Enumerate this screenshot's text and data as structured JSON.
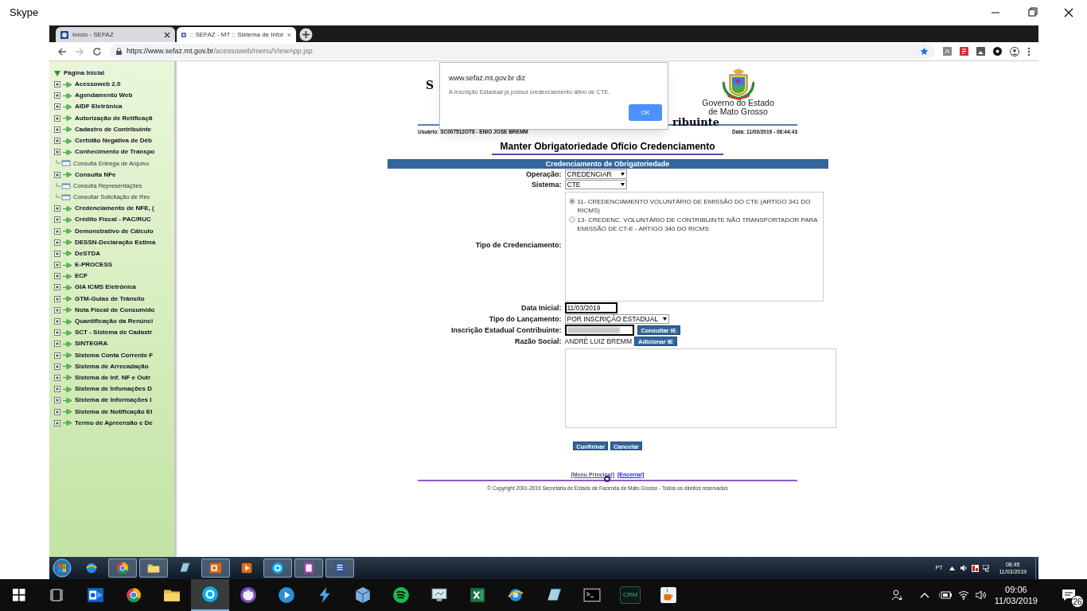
{
  "app_title": "Skype",
  "browser": {
    "tabs": [
      {
        "title": "Início - SEFAZ",
        "selected": false
      },
      {
        "title": ":: SEFAZ - MT :: Sistema de Infor",
        "selected": true
      }
    ],
    "url_host": "https://www.sefaz.mt.gov.br",
    "url_path": "/acessoweb/menu/ViewApp.jsp"
  },
  "sidebar": {
    "root": {
      "label": "Página Inicial",
      "expanded": true,
      "children": [
        {
          "label": "Acessoweb 2.0",
          "kind": "folder"
        },
        {
          "label": "Agendamento Web",
          "kind": "folder"
        },
        {
          "label": "AIDF Eletrônica",
          "kind": "folder"
        },
        {
          "label": "Autorização de Retificaçã",
          "kind": "folder"
        },
        {
          "label": "Cadastro de Contribuinte",
          "kind": "folder"
        },
        {
          "label": "Certidão Negativa de Déb",
          "kind": "folder"
        },
        {
          "label": "Conhecimento de Transpo",
          "kind": "folder"
        },
        {
          "label": "Consulta Entrega de Arquivo",
          "kind": "page"
        },
        {
          "label": "Consulta NFe",
          "kind": "folder"
        },
        {
          "label": "Consulta Representações",
          "kind": "page"
        },
        {
          "label": "Consultar Solicitação de Rev",
          "kind": "page"
        },
        {
          "label": "Credenciamento de NFE, (",
          "kind": "folder"
        },
        {
          "label": "Crédito Fiscal - PAC/RUC",
          "kind": "folder"
        },
        {
          "label": "Demonstrativo de Cálculo",
          "kind": "folder"
        },
        {
          "label": "DESSN-Declaração Estima",
          "kind": "folder"
        },
        {
          "label": "DeSTDA",
          "kind": "folder"
        },
        {
          "label": "E-PROCESS",
          "kind": "folder"
        },
        {
          "label": "ECF",
          "kind": "folder"
        },
        {
          "label": "GIA ICMS Eletrônica",
          "kind": "folder"
        },
        {
          "label": "GTM-Guias de Trânsito",
          "kind": "folder"
        },
        {
          "label": "Nota Fiscal de Consumido",
          "kind": "folder"
        },
        {
          "label": "Quantificação da Renúnci",
          "kind": "folder"
        },
        {
          "label": "SCT - Sistema de Cadastr",
          "kind": "folder"
        },
        {
          "label": "SINTEGRA",
          "kind": "folder"
        },
        {
          "label": "Sistema Conta Corrente F",
          "kind": "folder"
        },
        {
          "label": "Sistema de Arrecadação",
          "kind": "folder"
        },
        {
          "label": "Sistema de Inf. NF e Outr",
          "kind": "folder"
        },
        {
          "label": "Sistema de Infomações D",
          "kind": "folder"
        },
        {
          "label": "Sistema de Informações I",
          "kind": "folder"
        },
        {
          "label": "Sistema de Notificação El",
          "kind": "folder"
        },
        {
          "label": "Termo de Apreensão e De",
          "kind": "folder"
        }
      ]
    }
  },
  "header": {
    "title_fragment_left": "S",
    "title_fragment_right": "ribuinte",
    "government_name": "Governo do Estado",
    "government_state": "de Mato Grosso",
    "user": "Usuário: SC007512OT8 - ENIO JOSE BREMM",
    "date": "Data: 11/03/2019 - 08:44:43"
  },
  "page_title": "Manter Obrigatoriedade Ofício Credenciamento",
  "form": {
    "section_title": "Credenciamento de Obrigatoriedade",
    "fields": [
      {
        "kind": "select",
        "label": "Operação:",
        "value": "CREDENCIAR"
      },
      {
        "kind": "select",
        "label": "Sistema:",
        "value": "CTE"
      },
      {
        "kind": "radio_group",
        "label": "Tipo de Credenciamento:",
        "options": [
          {
            "text": "11- CREDENCIAMENTO VOLUNTÁRIO DE EMISSÃO DO CTE (ARTIGO 341 DO RICMS)",
            "selected": true
          },
          {
            "text": "13- CREDENC. VOLUNTÁRIO DE CONTRIBUINTE NÃO TRANSPORTADOR PARA EMISSÃO DE CT-E - ARTIGO 340 DO RICMS",
            "selected": false
          }
        ]
      },
      {
        "kind": "input",
        "label": "Data Inicial:",
        "value": "11/03/2019"
      },
      {
        "kind": "wide_select",
        "label": "Tipo do Lançamento:",
        "value": "POR INSCRIÇÃO ESTADUAL"
      },
      {
        "kind": "input_button",
        "label": "Inscrição Estadual Contribuinte:",
        "redacted": true,
        "button": "Consultar IE"
      },
      {
        "kind": "output_button",
        "label": "Razão Social:",
        "value": "ANDRÉ LUIZ BREMM",
        "button": "Adicionar IE"
      },
      {
        "kind": "textarea"
      }
    ],
    "buttons": [
      "Confirmar",
      "Cancelar"
    ]
  },
  "footer": {
    "links": [
      "[Menu Principal]",
      "[Encerrar]"
    ],
    "copyright": "© Copyright 2001-2019 Secretaria de Estado de Fazenda de Mato Grosso - Todos os direitos reservados"
  },
  "dialog": {
    "origin": "www.sefaz.mt.gov.br diz",
    "message": "A Inscrição Estadual já possui credenciamento ativo de CTE.",
    "button": "OK"
  },
  "remote_taskbar": {
    "apps": [
      {
        "running": false
      },
      {
        "running": true
      },
      {
        "running": true
      },
      {
        "running": false
      },
      {
        "running": true
      },
      {
        "running": false
      },
      {
        "running": true
      },
      {
        "running": true
      },
      {
        "running": true
      }
    ],
    "language": "PT",
    "time": "08:45",
    "date": "11/03/2019"
  },
  "local_taskbar": {
    "apps": [
      {
        "selected": false
      },
      {
        "selected": false
      },
      {
        "selected": false
      },
      {
        "selected": true
      },
      {
        "selected": false
      },
      {
        "selected": false
      },
      {
        "selected": false
      },
      {
        "selected": false
      },
      {
        "selected": false
      },
      {
        "selected": false
      },
      {
        "selected": false
      },
      {
        "selected": false
      },
      {
        "selected": false
      },
      {
        "selected": false
      },
      {
        "selected": false,
        "label": "CRM"
      },
      {
        "selected": false
      }
    ],
    "time": "09:06",
    "date": "11/03/2019",
    "notifications": "26"
  }
}
